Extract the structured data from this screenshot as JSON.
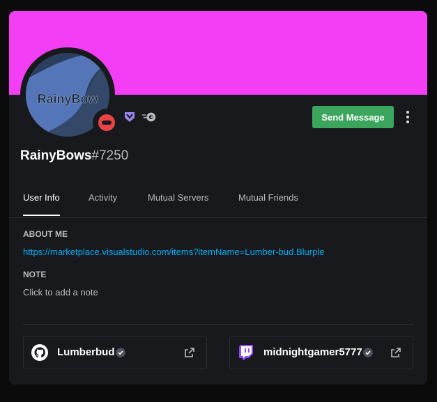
{
  "profile": {
    "username": "RainyBows",
    "discriminator": "#7250",
    "banner_color": "#f33ef6",
    "avatar_text": "RainyBow",
    "status": "do-not-disturb",
    "status_color": "#ed4245"
  },
  "badges": [
    {
      "icon": "hypesquad-balance-icon",
      "color": "#9c84ef"
    },
    {
      "icon": "nitro-boost-icon",
      "color": "#b9bbbe"
    }
  ],
  "actions": {
    "send_message_label": "Send Message",
    "send_message_color": "#3ba55d"
  },
  "tabs": [
    {
      "label": "User Info",
      "active": true
    },
    {
      "label": "Activity",
      "active": false
    },
    {
      "label": "Mutual Servers",
      "active": false
    },
    {
      "label": "Mutual Friends",
      "active": false
    }
  ],
  "about_me": {
    "title": "ABOUT ME",
    "link": "https://marketplace.visualstudio.com/items?itemName=Lumber-bud.Blurple"
  },
  "note": {
    "title": "NOTE",
    "placeholder": "Click to add a note"
  },
  "connections": [
    {
      "service_icon": "github-icon",
      "name": "Lumberbud",
      "verified": true
    },
    {
      "service_icon": "twitch-icon",
      "name": "midnightgamer5777",
      "verified": true
    }
  ],
  "colors": {
    "card_bg": "#18191c",
    "link": "#00aff4",
    "twitch": "#9146ff"
  }
}
